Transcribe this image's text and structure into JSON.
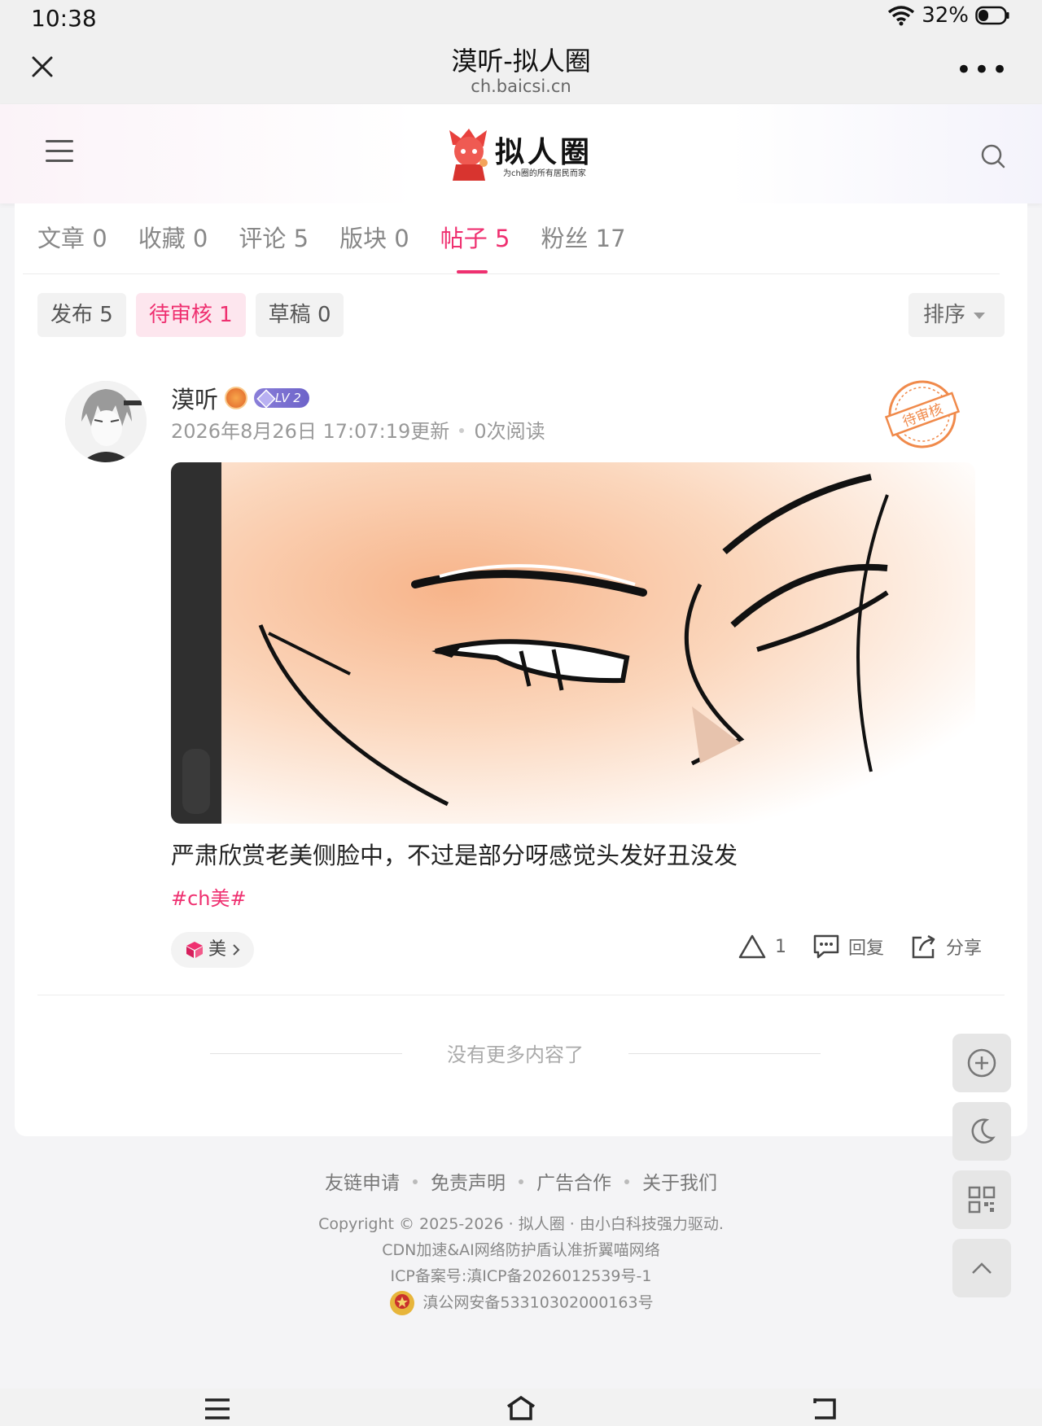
{
  "status": {
    "time": "10:38",
    "battery": "32%"
  },
  "browser": {
    "title": "漠听-拟人圈",
    "url": "ch.baicsi.cn",
    "more": "•••"
  },
  "site": {
    "logo_text": "拟人圈",
    "logo_sub": "为ch圈的所有居民而家"
  },
  "tabs": [
    {
      "label": "文章",
      "count": "0"
    },
    {
      "label": "收藏",
      "count": "0"
    },
    {
      "label": "评论",
      "count": "5"
    },
    {
      "label": "版块",
      "count": "0"
    },
    {
      "label": "帖子",
      "count": "5",
      "active": true
    },
    {
      "label": "粉丝",
      "count": "17"
    }
  ],
  "subtabs": [
    {
      "label": "发布",
      "count": "5"
    },
    {
      "label": "待审核",
      "count": "1",
      "active": true
    },
    {
      "label": "草稿",
      "count": "0"
    }
  ],
  "sort_label": "排序",
  "post": {
    "author": "漠听",
    "level": "LV 2",
    "updated": "2026年8月26日 17:07:19更新",
    "views": "0次阅读",
    "stamp": "待审核",
    "title": "严肃欣赏老美侧脸中，不过是部分呀感觉头发好丑没发",
    "tag": "#ch美#",
    "category": "美",
    "likes": "1",
    "reply": "回复",
    "share": "分享"
  },
  "no_more": "没有更多内容了",
  "footer": {
    "links": [
      "友链申请",
      "免责声明",
      "广告合作",
      "关于我们"
    ],
    "copyright": "Copyright © 2025-2026 · 拟人圈 · 由小白科技强力驱动.",
    "cdn": "CDN加速&AI网络防护盾认准折翼喵网络",
    "icp": "ICP备案号:滇ICP备2026012539号-1",
    "police": "滇公网安备53310302000163号"
  },
  "colors": {
    "accent": "#ef3070",
    "stamp": "#f08a4b"
  }
}
